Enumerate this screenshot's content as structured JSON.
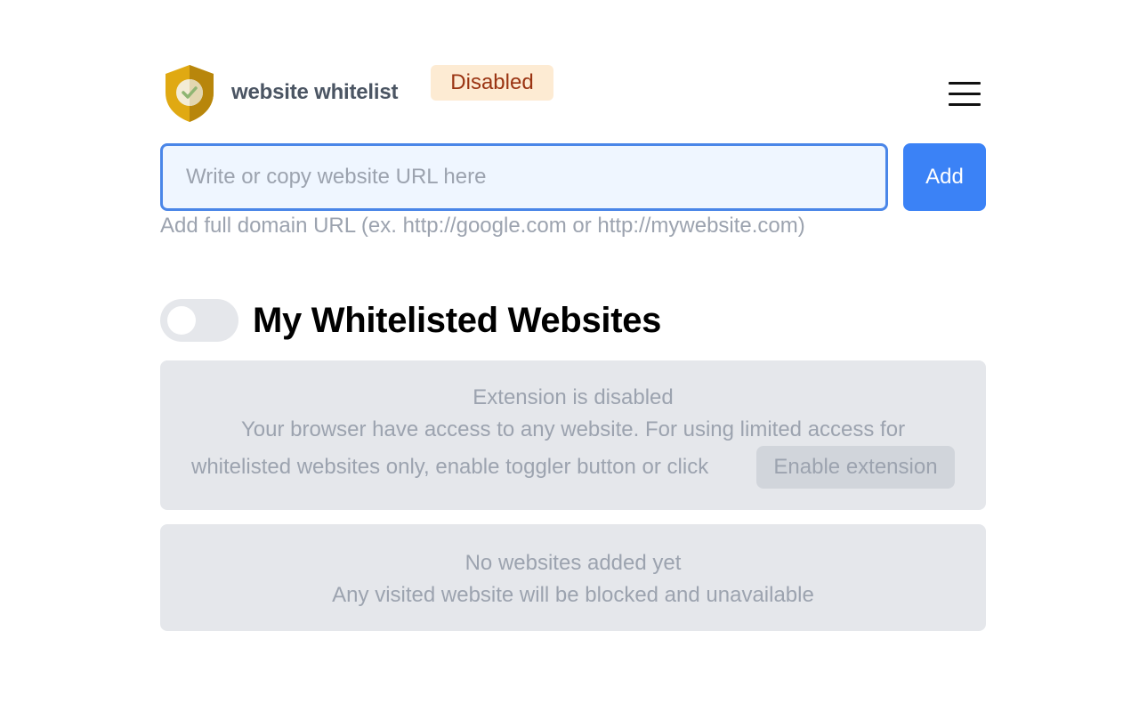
{
  "header": {
    "app_name": "website whitelist",
    "status_badge": "Disabled",
    "logo_icon": "shield-check-icon",
    "menu_icon": "hamburger-menu-icon"
  },
  "url_form": {
    "input_value": "",
    "input_placeholder": "Write or copy website URL here",
    "add_label": "Add",
    "hint": "Add full domain URL (ex. http://google.com or http://mywebsite.com)"
  },
  "whitelist": {
    "title": "My Whitelisted Websites",
    "toggle_on": false
  },
  "notice": {
    "title": "Extension is disabled",
    "line1": "Your browser have access to any website. For using limited access for",
    "line2": "whitelisted websites only, enable toggler button or click",
    "enable_label": "Enable extension"
  },
  "empty_state": {
    "title": "No websites added yet",
    "subtitle": "Any visited website will be blocked and unavailable"
  },
  "colors": {
    "accent": "#3b82f6",
    "badge_bg": "#fdebd3",
    "badge_text": "#9a3412",
    "shield_gold": "#d4a017",
    "box_bg": "#e5e7eb",
    "muted_text": "#9ca3af"
  }
}
